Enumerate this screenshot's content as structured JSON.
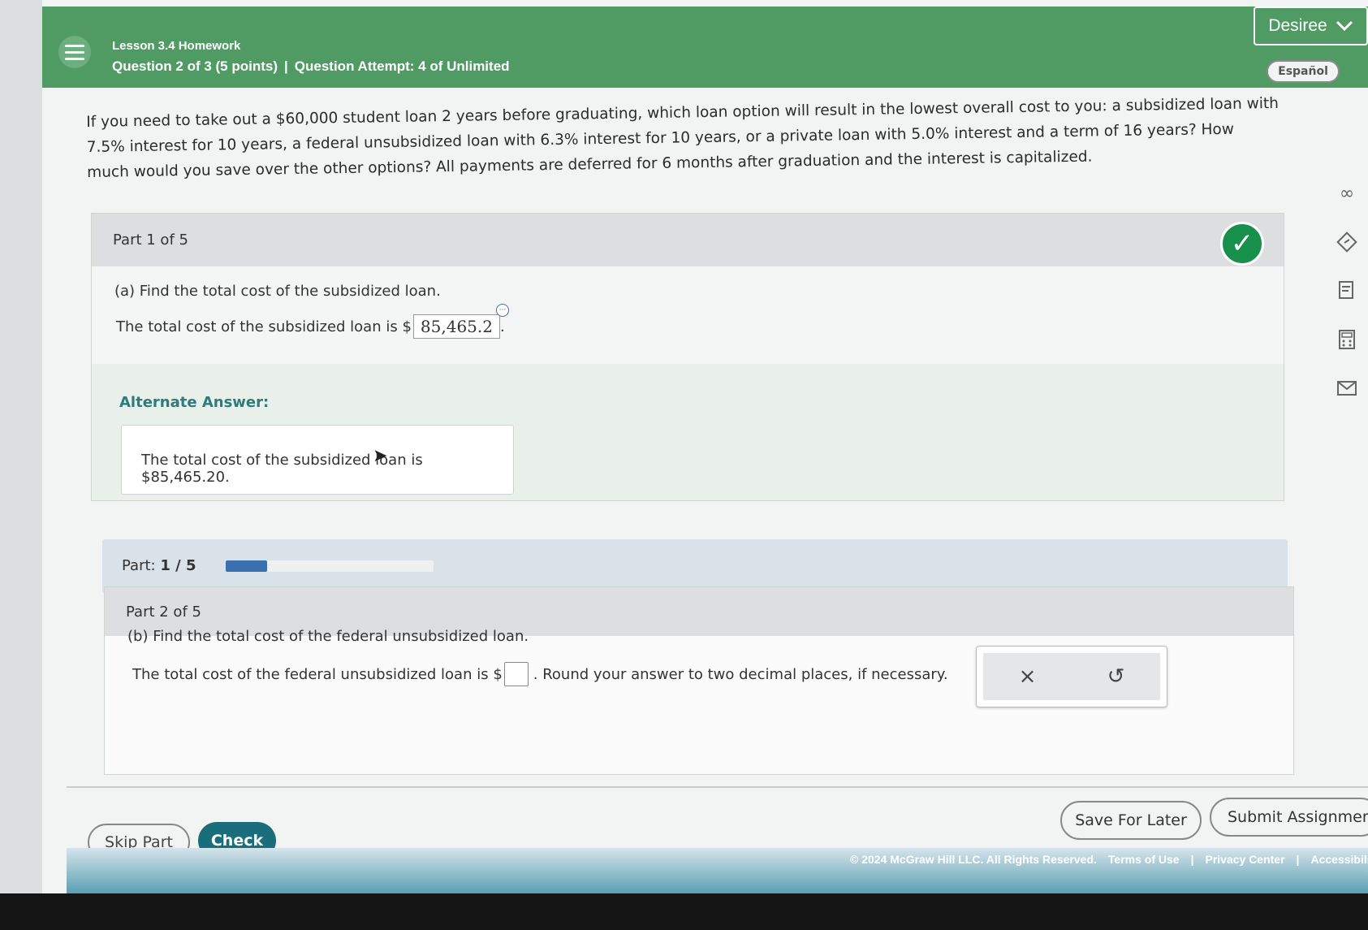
{
  "header": {
    "lesson_title": "Lesson 3.4 Homework",
    "question_info": "Question 2 of 3 (5 points)",
    "separator": "|",
    "attempt_info": "Question Attempt: 4 of Unlimited",
    "user_name": "Desiree",
    "language_button": "Español"
  },
  "question": {
    "text": "If you need to take out a $60,000 student loan 2 years before graduating, which loan option will result in the lowest overall cost to you: a subsidized loan with 7.5% interest for 10 years, a federal unsubsidized loan with 6.3% interest for 10 years, or a private loan with 5.0% interest and a term of 16 years? How much would you save over the other options? All payments are deferred for 6 months after graduation and the interest is capitalized."
  },
  "part1": {
    "label": "Part 1 of 5",
    "prompt": "(a) Find the total cost of the subsidized loan.",
    "answer_prefix": "The total cost of the subsidized loan is $",
    "answer_value": "85,465.2",
    "answer_suffix": ".",
    "alternate_label": "Alternate Answer:",
    "alternate_text": "The total cost of the subsidized loan is $85,465.20."
  },
  "progress": {
    "label": "Part:",
    "value": "1 / 5",
    "fraction": 0.2
  },
  "part2": {
    "label": "Part 2 of 5",
    "prompt": "(b) Find the total cost of the federal unsubsidized loan.",
    "answer_prefix": "The total cost of the federal unsubsidized loan is $",
    "answer_suffix": ". Round your answer to two decimal places, if necessary.",
    "clear_icon": "×",
    "undo_icon": "↺"
  },
  "footer": {
    "skip_label": "Skip Part",
    "check_label": "Check",
    "save_label": "Save For Later",
    "submit_label": "Submit Assignment",
    "copyright": "© 2024 McGraw Hill LLC. All Rights Reserved.",
    "terms": "Terms of Use",
    "privacy": "Privacy Center",
    "accessibility": "Accessibility"
  },
  "side_tools": [
    "infinity-icon",
    "hint-icon",
    "reference-icon",
    "calculator-icon",
    "mail-icon"
  ],
  "colors": {
    "header_green": "#4f9b63",
    "check_teal": "#1a6d7a",
    "correct_green": "#16904a",
    "alt_label": "#2f7a7a"
  }
}
